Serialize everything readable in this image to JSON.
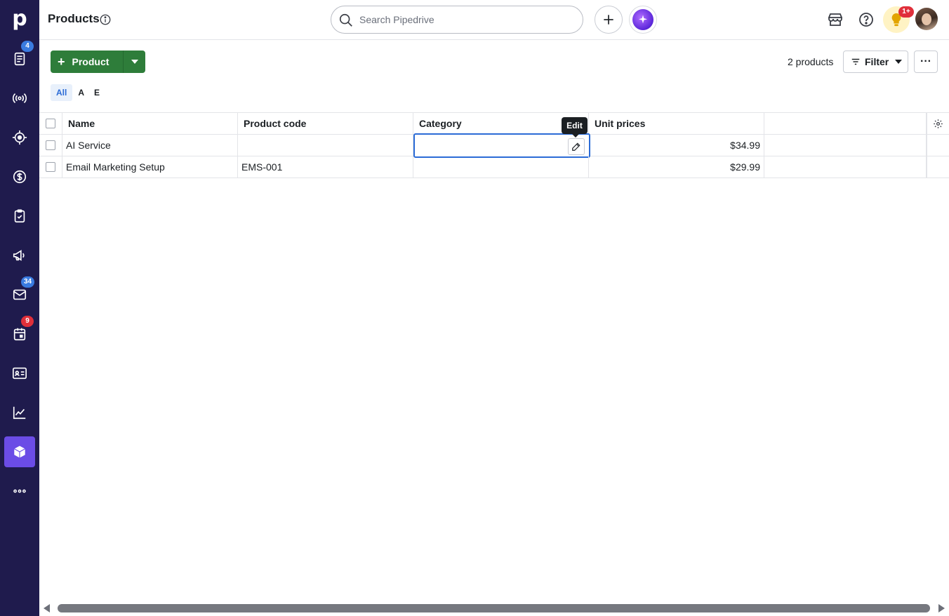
{
  "sidebar": {
    "logo": "p",
    "items": [
      {
        "name": "leads",
        "icon": "leads-inbox-icon",
        "badge": "4",
        "badge_color": "blue"
      },
      {
        "name": "campaigns-live",
        "icon": "broadcast-icon"
      },
      {
        "name": "target",
        "icon": "target-icon"
      },
      {
        "name": "deals",
        "icon": "dollar-icon"
      },
      {
        "name": "activities",
        "icon": "clipboard-check-icon"
      },
      {
        "name": "campaigns",
        "icon": "megaphone-icon"
      },
      {
        "name": "mail",
        "icon": "mail-icon",
        "badge": "34",
        "badge_color": "blue"
      },
      {
        "name": "calendar",
        "icon": "calendar-icon",
        "badge": "9",
        "badge_color": "red"
      },
      {
        "name": "contacts",
        "icon": "contact-card-icon"
      },
      {
        "name": "insights",
        "icon": "chart-line-icon"
      },
      {
        "name": "products",
        "icon": "product-box-icon",
        "active": true
      },
      {
        "name": "more",
        "icon": "more-dots-icon"
      }
    ]
  },
  "header": {
    "title": "Products",
    "search_placeholder": "Search Pipedrive",
    "notifications_badge": "1+"
  },
  "toolbar": {
    "add_label": "Product",
    "count_text": "2 products",
    "filter_label": "Filter",
    "more_label": "···",
    "letter_tabs": [
      "All",
      "A",
      "E"
    ],
    "active_letter": "All"
  },
  "table": {
    "columns": [
      "Name",
      "Product code",
      "Category",
      "Unit prices"
    ],
    "rows": [
      {
        "name": "AI Service",
        "code": "",
        "category": "",
        "unit_price": "$34.99"
      },
      {
        "name": "Email Marketing Setup",
        "code": "EMS-001",
        "category": "",
        "unit_price": "$29.99"
      }
    ]
  },
  "tooltip": "Edit",
  "colors": {
    "sidebar_bg": "#1f1b4d",
    "active_nav": "#6b4ce6",
    "primary_green": "#2e7d3a",
    "focus_blue": "#2b6bd6",
    "badge_blue": "#3a7be0",
    "badge_red": "#e02f3a"
  }
}
